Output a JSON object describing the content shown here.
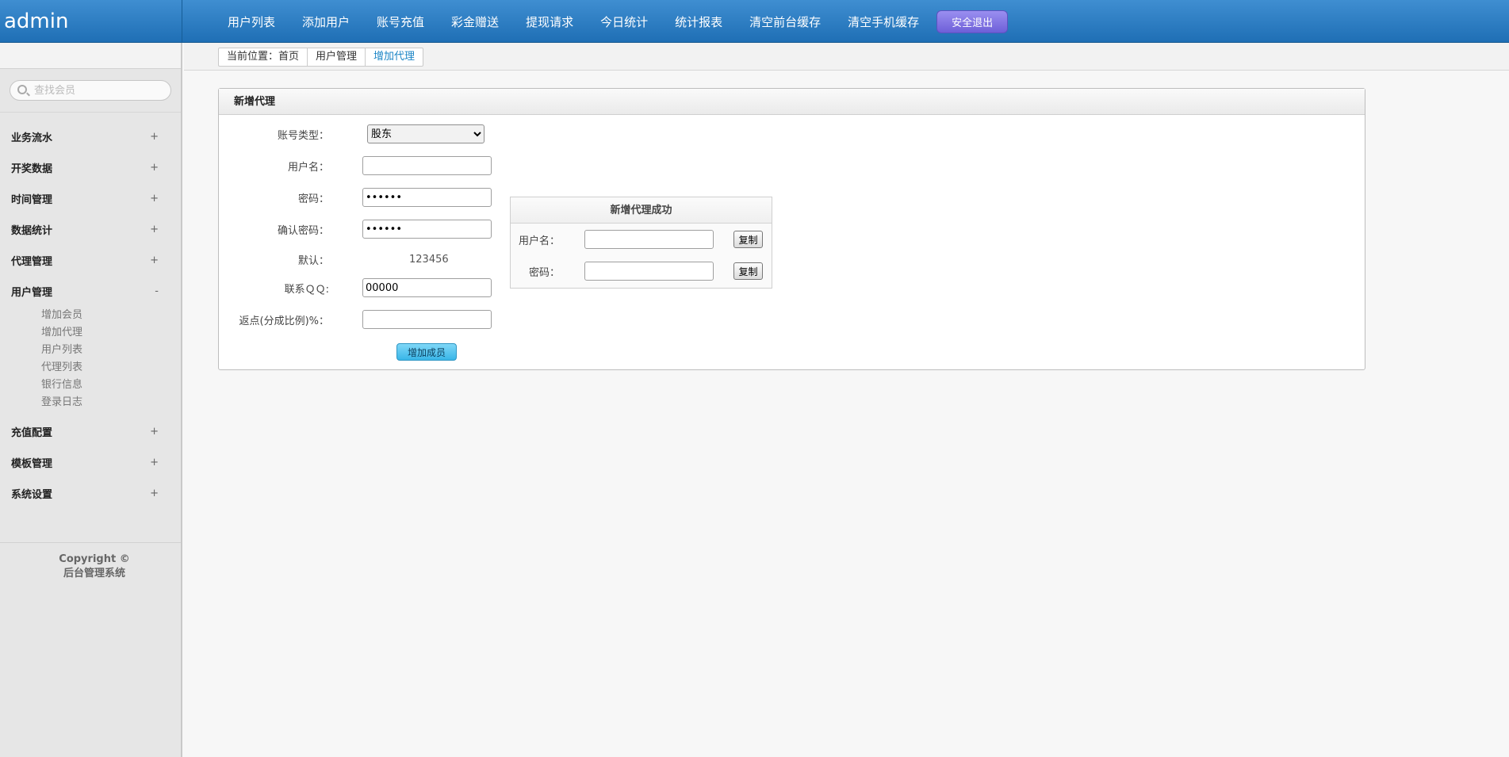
{
  "app": {
    "brand": "admin"
  },
  "topnav": {
    "items": [
      "用户列表",
      "添加用户",
      "账号充值",
      "彩金赠送",
      "提现请求",
      "今日统计",
      "统计报表",
      "清空前台缓存",
      "清空手机缓存"
    ],
    "logout_label": "安全退出"
  },
  "sidebar": {
    "search_placeholder": "查找会员",
    "groups": [
      {
        "label": "业务流水",
        "toggle": "+"
      },
      {
        "label": "开奖数据",
        "toggle": "+"
      },
      {
        "label": "时间管理",
        "toggle": "+"
      },
      {
        "label": "数据统计",
        "toggle": "+"
      },
      {
        "label": "代理管理",
        "toggle": "+"
      },
      {
        "label": "用户管理",
        "toggle": "-",
        "items": [
          "增加会员",
          "增加代理",
          "用户列表",
          "代理列表",
          "银行信息",
          "登录日志"
        ]
      },
      {
        "label": "充值配置",
        "toggle": "+"
      },
      {
        "label": "模板管理",
        "toggle": "+"
      },
      {
        "label": "系统设置",
        "toggle": "+"
      }
    ],
    "footer_line1": "Copyright ©",
    "footer_line2": "后台管理系统"
  },
  "breadcrumb": {
    "items": [
      "当前位置：首页",
      "用户管理",
      "增加代理"
    ]
  },
  "form": {
    "title": "新增代理",
    "account_type_label": "账号类型：",
    "account_type_value": "股东",
    "username_label": "用户名：",
    "username_value": "",
    "password_label": "密码：",
    "password_value": "123456",
    "confirm_label": "确认密码：",
    "confirm_value": "123456",
    "default_label": "默认：",
    "default_value": "123456",
    "qq_label": "联系ＱＱ:",
    "qq_value": "00000",
    "rebate_label": "返点(分成比例)%：",
    "rebate_value": "",
    "submit_label": "增加成员"
  },
  "result": {
    "title": "新增代理成功",
    "username_label": "用户名：",
    "password_label": "密码：",
    "copy_label": "复制"
  }
}
